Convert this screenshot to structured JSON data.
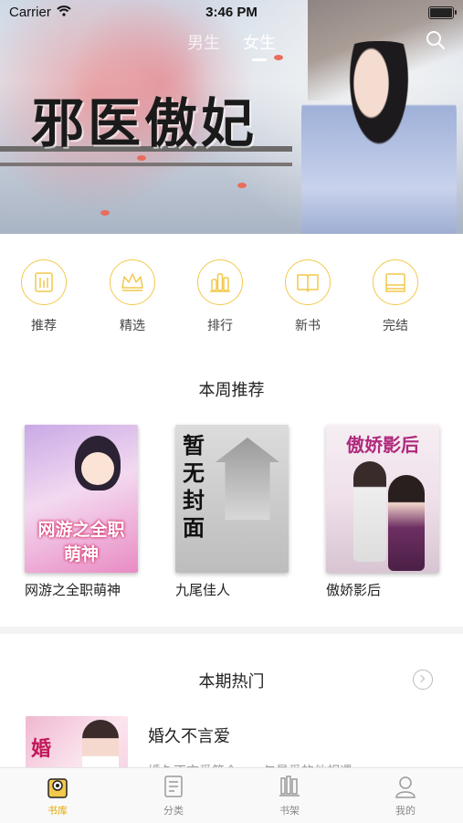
{
  "status_bar": {
    "carrier": "Carrier",
    "time": "3:46 PM"
  },
  "header": {
    "tabs": [
      {
        "label": "男生",
        "active": false
      },
      {
        "label": "女生",
        "active": true
      }
    ],
    "search_icon": "search-icon"
  },
  "banner": {
    "title": "邪医傲妃"
  },
  "categories": [
    {
      "label": "推荐",
      "icon": "recommend-icon"
    },
    {
      "label": "精选",
      "icon": "crown-icon"
    },
    {
      "label": "排行",
      "icon": "ranking-icon"
    },
    {
      "label": "新书",
      "icon": "open-book-icon"
    },
    {
      "label": "完结",
      "icon": "finished-book-icon"
    }
  ],
  "weekly": {
    "title": "本周推荐",
    "books": [
      {
        "title": "网游之全职萌神",
        "cover_text": "网游之全职萌神"
      },
      {
        "title": "九尾佳人",
        "cover_text": "暂无封面"
      },
      {
        "title": "傲娇影后",
        "cover_text": "傲娇影后"
      }
    ]
  },
  "hot": {
    "title": "本期热门",
    "item": {
      "title": "婚久不言爱",
      "desc": "婚久不言爱简介……与最爱的他相遇"
    }
  },
  "tabbar": [
    {
      "label": "书库",
      "icon": "library-icon",
      "active": true
    },
    {
      "label": "分类",
      "icon": "category-icon",
      "active": false
    },
    {
      "label": "书架",
      "icon": "bookshelf-icon",
      "active": false
    },
    {
      "label": "我的",
      "icon": "profile-icon",
      "active": false
    }
  ],
  "colors": {
    "accent": "#f2c94c",
    "active_tab": "#e0a800"
  }
}
